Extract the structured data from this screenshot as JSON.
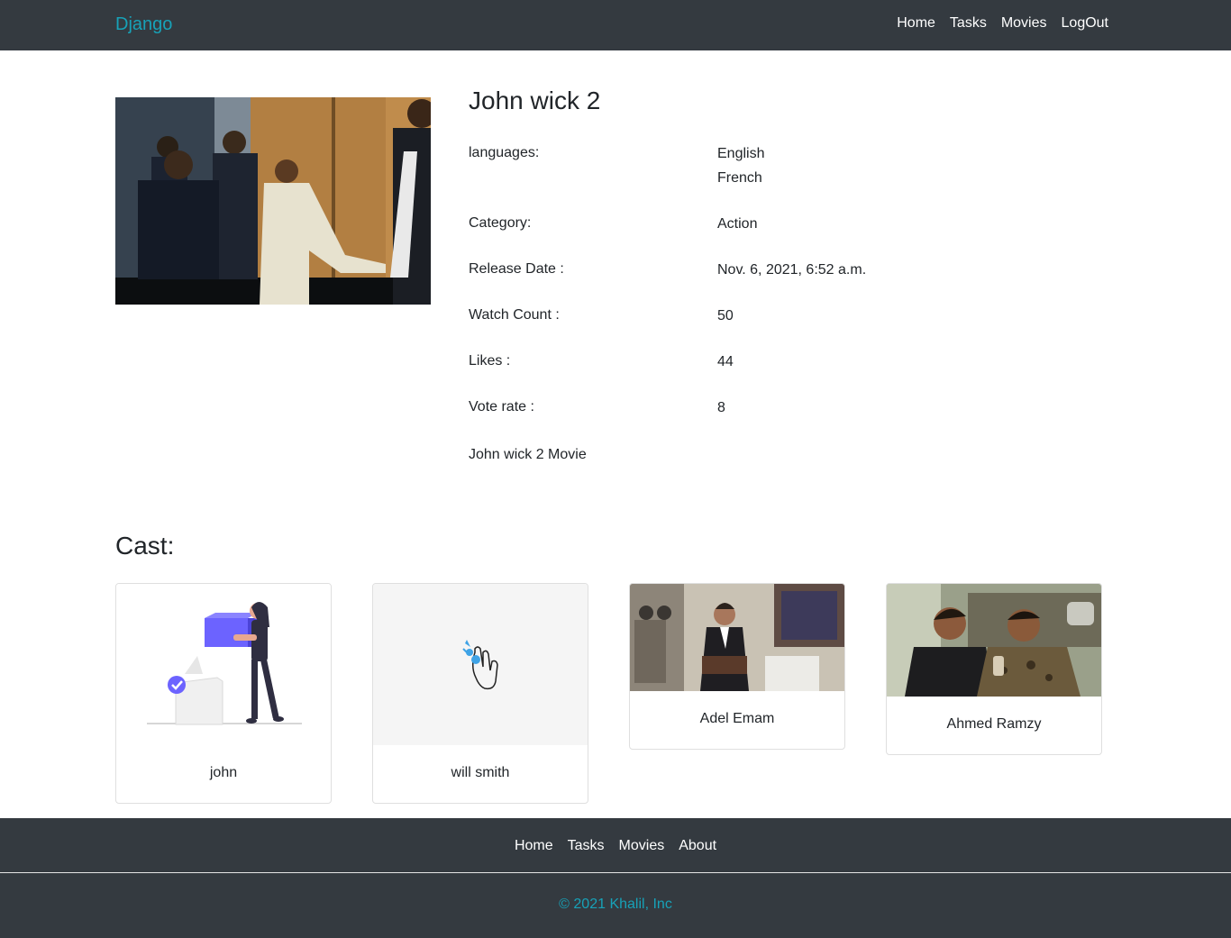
{
  "navbar": {
    "brand": "Django",
    "links": [
      "Home",
      "Tasks",
      "Movies",
      "LogOut"
    ]
  },
  "movie": {
    "title": "John wick 2",
    "languages_label": "languages:",
    "languages": [
      "English",
      "French"
    ],
    "category_label": "Category:",
    "category": "Action",
    "release_label": "Release Date :",
    "release_date": "Nov. 6, 2021, 6:52 a.m.",
    "watch_label": "Watch Count :",
    "watch_count": "50",
    "likes_label": "Likes :",
    "likes": "44",
    "vote_label": "Vote rate :",
    "vote_rate": "8",
    "description": "John wick 2 Movie"
  },
  "cast": {
    "heading": "Cast:",
    "members": [
      {
        "name": "john"
      },
      {
        "name": "will smith"
      },
      {
        "name": "Adel Emam"
      },
      {
        "name": "Ahmed Ramzy"
      }
    ]
  },
  "footer": {
    "links": [
      "Home",
      "Tasks",
      "Movies",
      "About"
    ],
    "copyright": "© 2021 Khalil, Inc"
  },
  "colors": {
    "navbar_bg": "#343a40",
    "brand": "#17a2b8",
    "illustration_accent": "#6c63ff"
  }
}
